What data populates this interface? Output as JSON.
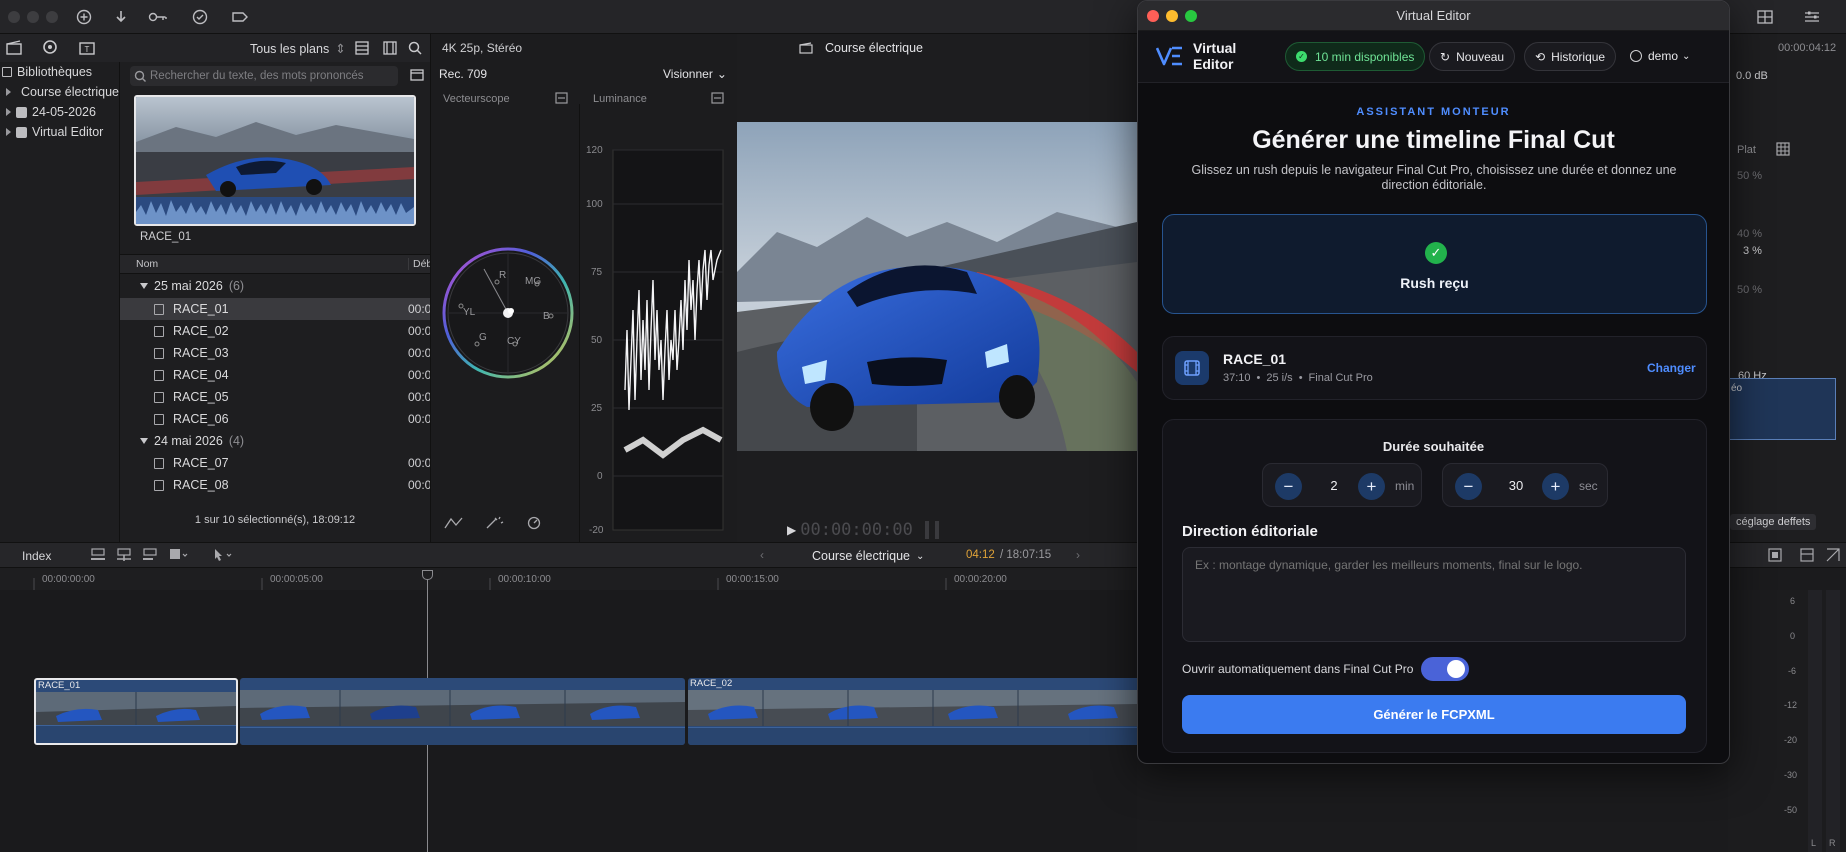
{
  "fcp": {
    "browser": {
      "filter_label": "Tous les plans",
      "search_placeholder": "Rechercher du texte, des mots prononcés",
      "libraries_label": "Bibliothèques",
      "libraries": [
        "Course électrique",
        "24-05-2026",
        "Virtual Editor"
      ],
      "thumb_label": "RACE_01",
      "col_name": "Nom",
      "col_start": "Débu",
      "groups": [
        {
          "label": "25 mai 2026",
          "count": "(6)",
          "clips": [
            "RACE_01",
            "RACE_02",
            "RACE_03",
            "RACE_04",
            "RACE_05",
            "RACE_06"
          ]
        },
        {
          "label": "24 mai 2026",
          "count": "(4)",
          "clips": [
            "RACE_07",
            "RACE_08"
          ]
        }
      ],
      "clip_tc": "00:0",
      "selection_status": "1 sur 10 sélectionné(s), 18:09:12"
    },
    "viewer": {
      "format": "4K 25p, Stéréo",
      "project": "Course électrique",
      "colorspace": "Rec. 709",
      "view_menu": "Visionner",
      "vectorscope_label": "Vecteurscope",
      "luminance_label": "Luminance",
      "lum_ticks": [
        "120",
        "100",
        "75",
        "50",
        "25",
        "0",
        "-20"
      ],
      "vector_labels": [
        "R",
        "MG",
        "B",
        "CY",
        "G",
        "YL"
      ],
      "timecode": "00:00:00:00"
    },
    "timeline": {
      "index_label": "Index",
      "project": "Course électrique",
      "position": "04:12",
      "duration": "/ 18:07:15",
      "ruler": [
        "00:00:00:00",
        "00:00:05:00",
        "00:00:10:00",
        "00:00:15:00",
        "00:00:20:00"
      ],
      "clips": [
        "RACE_01",
        "RACE_02"
      ]
    },
    "inspector": {
      "tc": "00:00:04:12",
      "db": "0.0 dB",
      "flat": "Plat",
      "p50": "50 %",
      "p40": "40 %",
      "p3": "3 %",
      "p50b": "50 %",
      "hz": "60 Hz",
      "video_label": "éo",
      "fx_button": "céglage deffets",
      "meter_ticks": [
        "6",
        "0",
        "-6",
        "-12",
        "-20",
        "-30",
        "-50"
      ],
      "meter_lr": [
        "L",
        "R"
      ]
    }
  },
  "ve": {
    "window_title": "Virtual Editor",
    "logo_text": "VE",
    "brand_line1": "Virtual",
    "brand_line2": "Editor",
    "credits": "10 min disponibles",
    "new_label": "Nouveau",
    "history_label": "Historique",
    "user_label": "demo",
    "eyebrow": "ASSISTANT MONTEUR",
    "title": "Générer une timeline Final Cut",
    "subtitle": "Glissez un rush depuis le navigateur Final Cut Pro, choisissez une durée et donnez une direction éditoriale.",
    "dropzone_status": "Rush reçu",
    "rush": {
      "name": "RACE_01",
      "duration": "37:10",
      "fps": "25 i/s",
      "source": "Final Cut Pro",
      "change_label": "Changer"
    },
    "duration_title": "Durée souhaitée",
    "minutes_value": "2",
    "minutes_unit": "min",
    "seconds_value": "30",
    "seconds_unit": "sec",
    "direction_title": "Direction éditoriale",
    "direction_placeholder": "Ex : montage dynamique, garder les meilleurs moments, final sur le logo.",
    "auto_open_label": "Ouvrir automatiquement dans Final Cut Pro",
    "auto_open_on": true,
    "generate_label": "Générer le FCPXML",
    "accent": "#3b7bf0",
    "success": "#22b24c"
  }
}
